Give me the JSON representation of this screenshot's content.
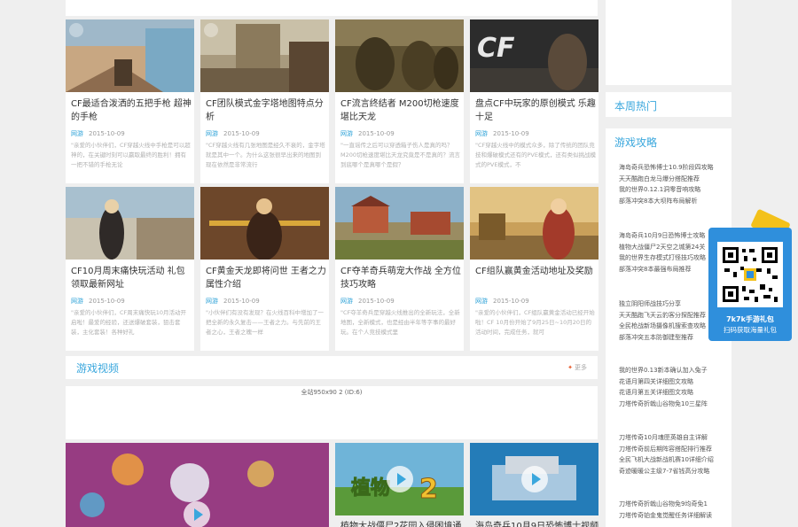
{
  "articles": [
    {
      "title": "CF最适合泼洒的五把手枪 超神的手枪",
      "source": "网游",
      "date": "2015-10-09",
      "desc": "\"亲爱的小伙伴们，CF穿越火线中手枪是可以超神的，在关键时刻可以赢取最终的胜利！拥有一把不错的手枪无论"
    },
    {
      "title": "CF团队模式金字塔地图特点分析",
      "source": "网游",
      "date": "2015-10-09",
      "desc": "\"CF穿越火线有几张地图是经久不衰的，金字塔就是其中一个。为什么这张很早出来的地图到现在依然是非常流行"
    },
    {
      "title": "CF流言终结者 M200切枪速度堪比天龙",
      "source": "网游",
      "date": "2015-10-09",
      "desc": "\"一直谣传之后可以穿透箱子伤人是真的吗？M200切枪速度堪比天龙究竟是不是真的？流言到底哪个是真哪个是假？"
    },
    {
      "title": "盘点CF中玩家的原创模式 乐趣十足",
      "source": "网游",
      "date": "2015-10-09",
      "desc": "\"CF穿越火线中的模式众多，除了传统的团队竞技和爆破模式还有的PVE模式，还有类似挑战模式的PVE模式，不"
    },
    {
      "title": "CF10月周末痛快玩活动 礼包领取最新网址",
      "source": "网游",
      "date": "2015-10-09",
      "desc": "\"亲爱的小伙伴们，CF周末痛快玩10月活动开启啦！最爱的经验，还送爆破套装，狙击套装，主化套装！各种好礼"
    },
    {
      "title": "CF黄金天龙即将问世 王者之力属性介绍",
      "source": "网游",
      "date": "2015-10-09",
      "desc": "\"小伙伴们有没有发现？在火线百科中增加了一把全新的永久复击——王者之力。与先前的王者之心，王者之魄一样"
    },
    {
      "title": "CF夺羊奇兵萌宠大作战 全方位技巧攻略",
      "source": "网游",
      "date": "2015-10-09",
      "desc": "\"CF夺羊奇兵是穿越火线推出的全新玩法，全新地图，全新模式，也是经由半年等字事的最好玩。在个人竞技模式里"
    },
    {
      "title": "CF组队赢黄金活动地址及奖励",
      "source": "网游",
      "date": "2015-10-09",
      "desc": "\"亲爱的小伙伴们，CF组队赢黄金活动已经开始啦！CF 10月份开始了9月25日~10月20日的活动时间，完成任务，就可"
    }
  ],
  "section": {
    "title": "游戏视频",
    "more": "更多"
  },
  "ad_text": "全站950x90 2 (ID:6)",
  "videos": [
    {
      "caption": ""
    },
    {
      "caption": "植物大战僵尸2花园入侵困境通..."
    },
    {
      "caption": "海岛奇兵10月9日恐怖博士视频..."
    }
  ],
  "sidebar": {
    "hot_title": "本周热门",
    "guide_title": "游戏攻略",
    "groups": [
      [
        "海岛奇兵恐怖博士10.9阶段四攻略",
        "天天酷跑白龙马爆分搭配推荐",
        "我的世界0.12.1洞零音响攻略",
        "部落冲突8本大坝阵布局解析"
      ],
      [
        "海岛奇兵10月9日恐怖博士攻略",
        "植物大战僵尸2天空之城第24关",
        "我的世界生存模式打怪技巧攻略",
        "部落冲突8本最强布局推荐"
      ],
      [
        "独立阴阳师战技巧分享",
        "天天酷跑飞天云豹客分探配推荐",
        "全民枪战新场摄像机搜索查攻略",
        "部落冲突五本防御建型推荐"
      ],
      [
        "我的世界0.13新本确认加入兔子",
        "花语月第四关详细图文攻略",
        "花语月第五关详细图文攻略",
        "刀塔传奇折戟山谷物免10三星阵"
      ],
      [
        "刀塔传奇10月魂匣英雄自主详解",
        "刀塔传奇前后期阵容搭配排行推荐",
        "全民飞机大战新战机赛10详细介绍",
        "奇迹暖暖公主级7-7省钱高分攻略"
      ],
      [
        "刀塔传奇折戟山谷物免9均奇免1",
        "刀塔传奇铂金鬼觉醒任务详细解读"
      ]
    ]
  },
  "qr": {
    "line1": "7k7k手游礼包",
    "line2": "扫码获取海量礼包"
  }
}
